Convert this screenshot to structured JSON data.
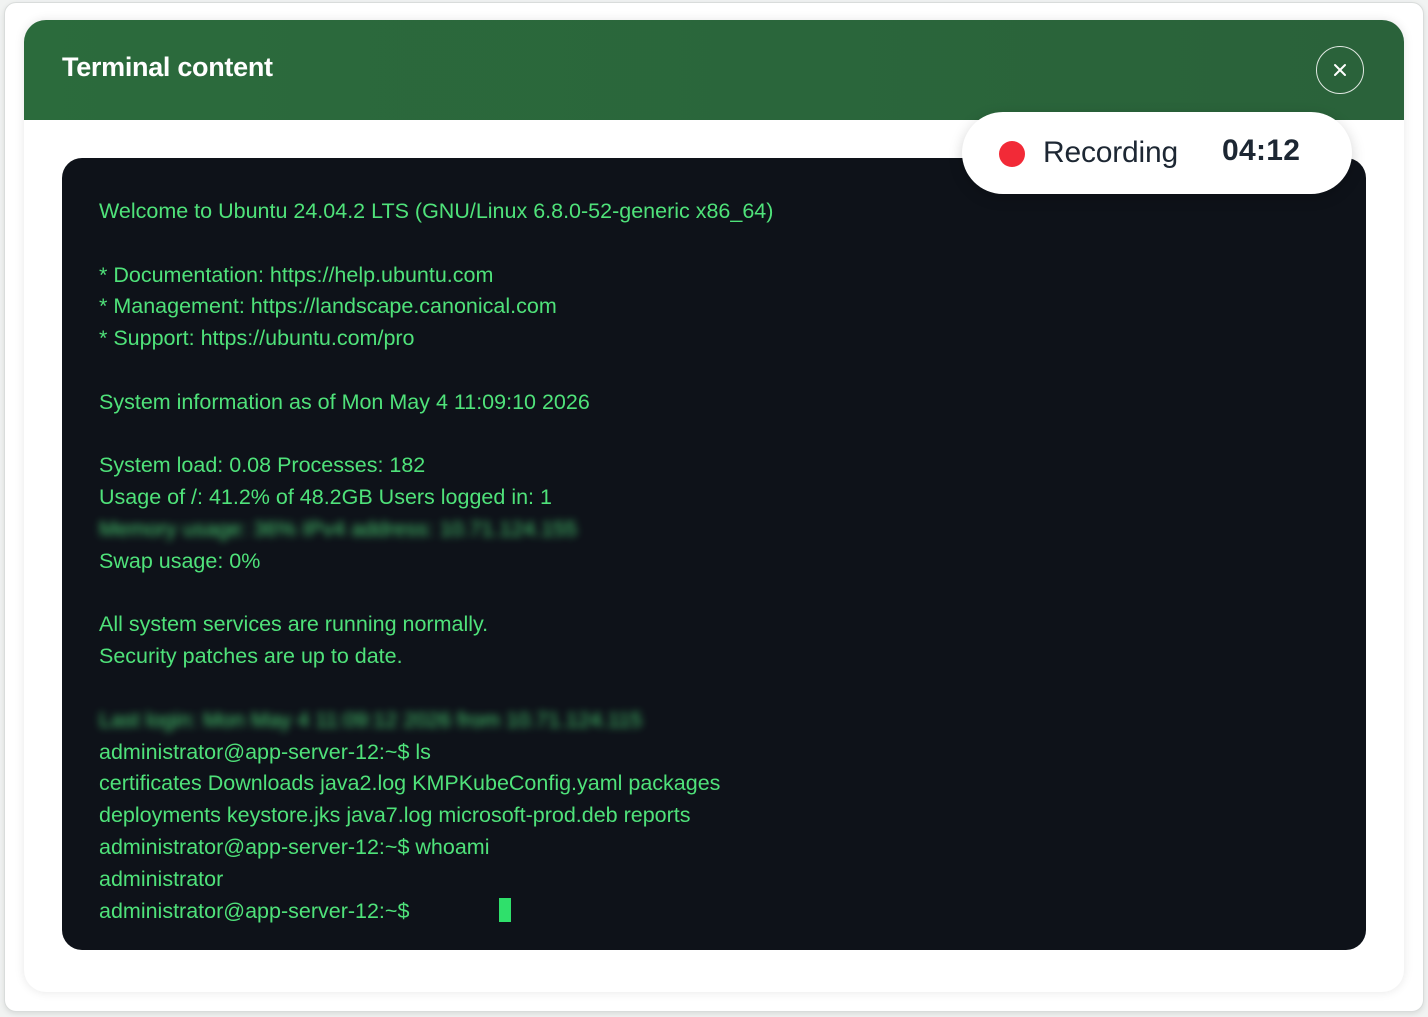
{
  "modal": {
    "title": "Terminal content",
    "close_icon": "close-icon"
  },
  "recording": {
    "label": "Recording",
    "time": "04:12",
    "dot_color": "#f22a37"
  },
  "terminal": {
    "text_color": "#4fe27a",
    "background": "#0e1219",
    "lines": [
      "Welcome to Ubuntu 24.04.2 LTS (GNU/Linux 6.8.0-52-generic x86_64)",
      "",
      "* Documentation: https://help.ubuntu.com",
      "* Management: https://landscape.canonical.com",
      "* Support: https://ubuntu.com/pro",
      "",
      "System information as of Mon May 4 11:09:10 2026",
      "",
      "System load: 0.08 Processes: 182",
      "Usage of /: 41.2% of 48.2GB Users logged in: 1",
      "Memory usage: 36% IPv4 address: 10.71.124.155",
      "Swap usage: 0%",
      "",
      "All system services are running normally.",
      "Security patches are up to date.",
      "",
      "Last login: Mon May 4 11:09:12 2026 from 10.71.124.115",
      "administrator@app-server-12:~$ ls",
      "certificates Downloads java2.log KMPKubeConfig.yaml packages",
      "deployments keystore.jks java7.log microsoft-prod.deb reports",
      "administrator@app-server-12:~$ whoami",
      "administrator",
      "administrator@app-server-12:~$"
    ]
  }
}
